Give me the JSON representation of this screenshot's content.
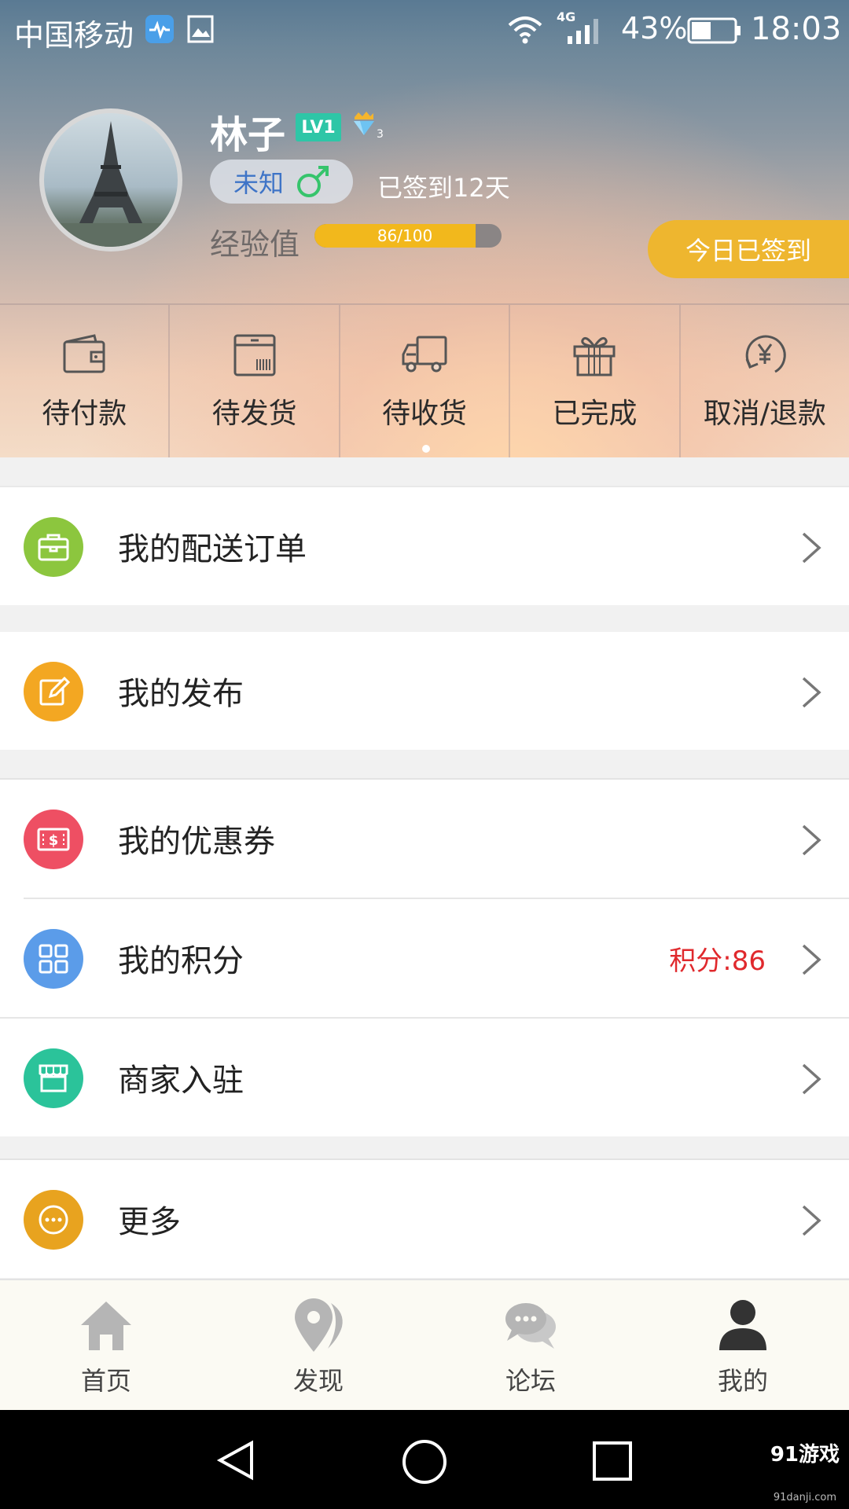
{
  "status_bar": {
    "carrier": "中国移动",
    "network": "4G",
    "battery": "43%",
    "time": "18:03"
  },
  "profile": {
    "name": "林子",
    "level": "LV1",
    "crown_count": "3",
    "gender": "未知",
    "signed_days": "已签到12天",
    "exp_label": "经验值",
    "exp_text": "86/100",
    "exp_progress": 0.86,
    "checkin_button": "今日已签到"
  },
  "orders": [
    {
      "label": "待付款",
      "icon": "wallet-icon"
    },
    {
      "label": "待发货",
      "icon": "package-icon"
    },
    {
      "label": "待收货",
      "icon": "truck-icon"
    },
    {
      "label": "已完成",
      "icon": "gift-icon"
    },
    {
      "label": "取消/退款",
      "icon": "refund-icon"
    }
  ],
  "menu": {
    "delivery": {
      "label": "我的配送订单",
      "icon": "briefcase-icon",
      "color": "#8cc63e"
    },
    "posts": {
      "label": "我的发布",
      "icon": "edit-icon",
      "color": "#f3a722"
    },
    "coupons": {
      "label": "我的优惠券",
      "icon": "coupon-icon",
      "color": "#ee4f63"
    },
    "points": {
      "label": "我的积分",
      "icon": "grid-icon",
      "color": "#5b9ce9",
      "extra": "积分:86"
    },
    "merchant": {
      "label": "商家入驻",
      "icon": "store-icon",
      "color": "#2bc39a"
    },
    "more": {
      "label": "更多",
      "icon": "more-icon",
      "color": "#e8a31f"
    }
  },
  "tabs": [
    {
      "label": "首页",
      "icon": "home-icon"
    },
    {
      "label": "发现",
      "icon": "location-icon"
    },
    {
      "label": "论坛",
      "icon": "chat-icon"
    },
    {
      "label": "我的",
      "icon": "user-icon"
    }
  ],
  "watermark": {
    "logo": "91游戏",
    "url": "91danji.com"
  }
}
